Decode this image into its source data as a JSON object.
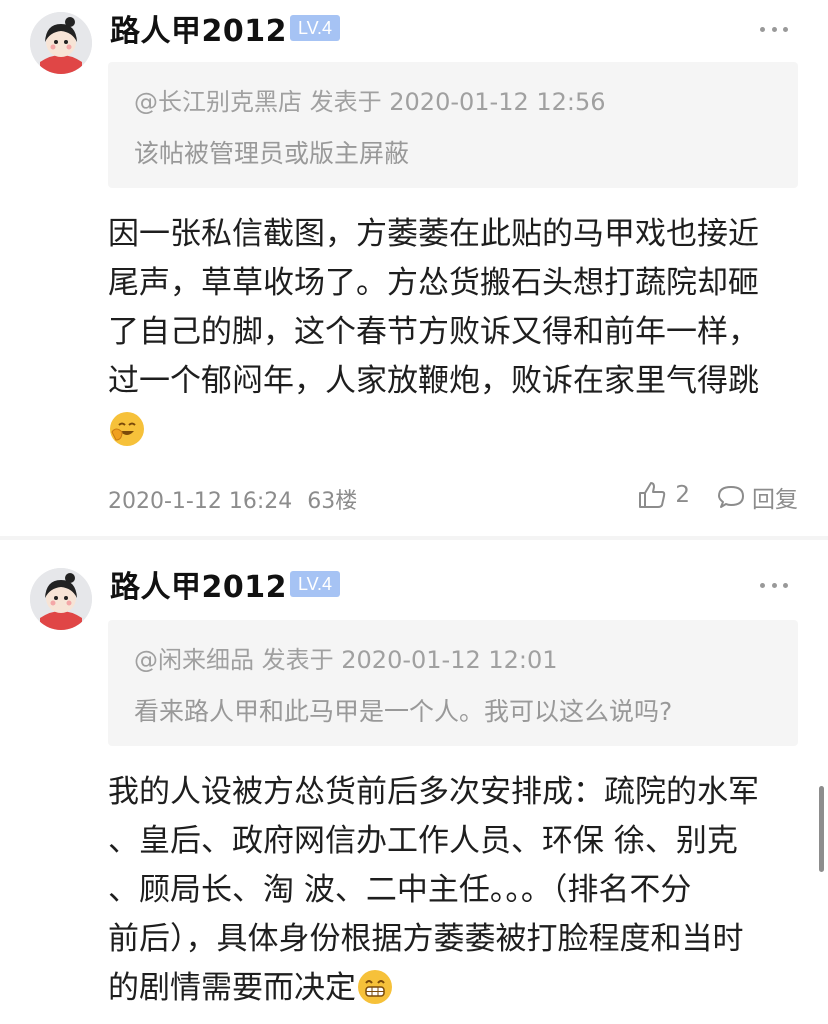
{
  "posts": [
    {
      "username": "路人甲2012",
      "level": "LV.4",
      "quote_meta": "@长江别克黑店 发表于 2020-01-12 12:56",
      "quote_body": "该帖被管理员或版主屏蔽",
      "content_lines": [
        "因一张私信截图，方萎萎在此贴的马甲戏也接近",
        "尾声，草草收场了。方怂货搬石头想打蔬院却砸",
        "了自己的脚，这个春节方败诉又得和前年一样，",
        "过一个郁闷年，人家放鞭炮，败诉在家里气得跳"
      ],
      "emoji": "grin-hand-emoji",
      "timestamp": "2020-1-12 16:24",
      "floor": "63楼",
      "like_count": "2",
      "reply_label": "回复"
    },
    {
      "username": "路人甲2012",
      "level": "LV.4",
      "quote_meta": "@闲来细品 发表于 2020-01-12 12:01",
      "quote_body": "看来路人甲和此马甲是一个人。我可以这么说吗?",
      "content_lines": [
        "我的人设被方怂货前后多次安排成：疏院的水军",
        "、皇后、政府网信办工作人员、环保 徐、别克",
        "、顾局长、淘 波、二中主任。。。（排名不分",
        "前后），具体身份根据方萎萎被打脸程度和当时",
        "的剧情需要而决定"
      ],
      "emoji": "grin-emoji"
    }
  ],
  "colors": {
    "badge": "#a6c3f4",
    "quote_bg": "#f5f5f5",
    "meta_text": "#8c8c8c",
    "emoji": "#f6c13a"
  }
}
